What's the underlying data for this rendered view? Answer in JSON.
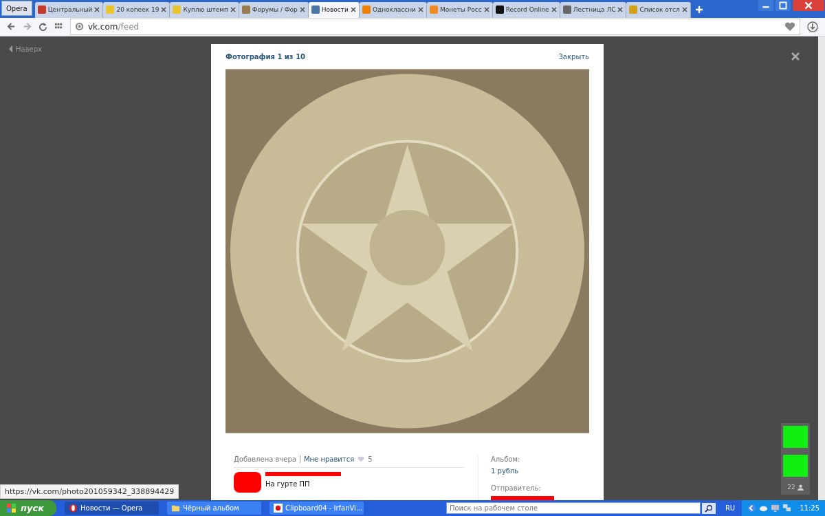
{
  "browser": {
    "menu_label": "Opera",
    "tabs": [
      {
        "label": "Центральный",
        "selected": false,
        "color": "#c0392b"
      },
      {
        "label": "20 копеек 19",
        "selected": false,
        "color": "#e8c530"
      },
      {
        "label": "Куплю штемп",
        "selected": false,
        "color": "#e8c530"
      },
      {
        "label": "Форумы / Фор",
        "selected": false,
        "color": "#9a7a50"
      },
      {
        "label": "Новости",
        "selected": true,
        "color": "#4a76a8"
      },
      {
        "label": "Одноклассни",
        "selected": false,
        "color": "#ee8208"
      },
      {
        "label": "Монеты Росс",
        "selected": false,
        "color": "#f08a24"
      },
      {
        "label": "Record Online",
        "selected": false,
        "color": "#111111"
      },
      {
        "label": "Лестница ЛС",
        "selected": false,
        "color": "#666666"
      },
      {
        "label": "Список отсл",
        "selected": false,
        "color": "#d4a017"
      }
    ],
    "address": {
      "host": "vk.com",
      "path": "/feed"
    }
  },
  "page": {
    "back_to_top": "Наверх",
    "online_count": "22"
  },
  "photo_viewer": {
    "title": "Фотография 1 из 10",
    "close": "Закрыть",
    "added": "Добавлена вчера",
    "like": "Мне нравится",
    "like_count": "5",
    "caption": "На гурте ПП",
    "album_label": "Альбом:",
    "album": "1 рубль",
    "sender_label": "Отправитель:"
  },
  "status_url": "https://vk.com/photo201059342_338894429",
  "taskbar": {
    "start": "пуск",
    "tasks": [
      {
        "label": "Новости — Opera",
        "selected": true,
        "kind": "opera"
      },
      {
        "label": "Чёрный альбом",
        "selected": false,
        "kind": "folder"
      },
      {
        "label": "Clipboard04 - IrfanVi...",
        "selected": false,
        "kind": "irfan"
      }
    ],
    "search_placeholder": "Поиск на рабочем столе",
    "language": "RU",
    "time": "11:25"
  }
}
